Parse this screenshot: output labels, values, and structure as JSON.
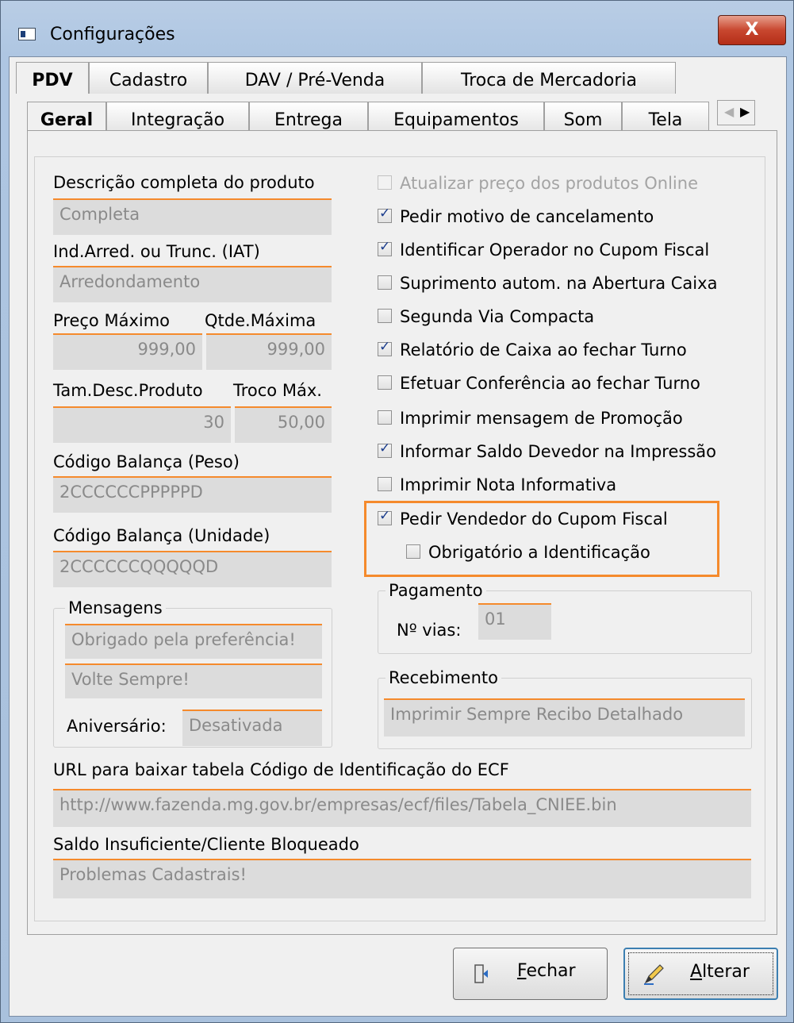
{
  "window": {
    "title": "Configurações",
    "close_label": "X"
  },
  "tabs_row1": [
    "PDV",
    "Cadastro",
    "DAV / Pré-Venda",
    "Troca de Mercadoria"
  ],
  "tabs_row2": [
    "Geral",
    "Integração",
    "Entrega",
    "Equipamentos",
    "Som",
    "Tela"
  ],
  "left": {
    "descricao_label": "Descrição completa do produto",
    "descricao_value": "Completa",
    "iat_label": "Ind.Arred. ou Trunc. (IAT)",
    "iat_value": "Arredondamento",
    "preco_max_label": "Preço Máximo",
    "qtde_max_label": "Qtde.Máxima",
    "preco_max_value": "999,00",
    "qtde_max_value": "999,00",
    "tam_desc_label": "Tam.Desc.Produto",
    "troco_max_label": "Troco Máx.",
    "tam_desc_value": "30",
    "troco_max_value": "50,00",
    "cod_peso_label": "Código Balança (Peso)",
    "cod_peso_value": "2CCCCCCPPPPPD",
    "cod_unid_label": "Código Balança (Unidade)",
    "cod_unid_value": "2CCCCCCQQQQQD"
  },
  "mensagens": {
    "title": "Mensagens",
    "msg1": "Obrigado pela preferência!",
    "msg2": "Volte Sempre!",
    "aniversario_label": "Aniversário:",
    "aniversario_value": "Desativada"
  },
  "checkboxes": [
    {
      "label": "Atualizar preço dos produtos Online",
      "checked": false,
      "disabled": true
    },
    {
      "label": "Pedir motivo de cancelamento",
      "checked": true,
      "disabled": false
    },
    {
      "label": "Identificar Operador no Cupom Fiscal",
      "checked": true,
      "disabled": false
    },
    {
      "label": "Suprimento autom. na Abertura Caixa",
      "checked": false,
      "disabled": false
    },
    {
      "label": "Segunda Via Compacta",
      "checked": false,
      "disabled": false
    },
    {
      "label": "Relatório de Caixa ao fechar Turno",
      "checked": true,
      "disabled": false
    },
    {
      "label": "Efetuar Conferência ao fechar Turno",
      "checked": false,
      "disabled": false
    },
    {
      "label": "Imprimir mensagem de Promoção",
      "checked": false,
      "disabled": false
    },
    {
      "label": "Informar Saldo Devedor na Impressão",
      "checked": true,
      "disabled": false
    },
    {
      "label": "Imprimir Nota Informativa",
      "checked": false,
      "disabled": false
    },
    {
      "label": "Pedir Vendedor do Cupom Fiscal",
      "checked": true,
      "disabled": false
    },
    {
      "label": "Obrigatório a Identificação",
      "checked": false,
      "disabled": false
    }
  ],
  "pagamento": {
    "title": "Pagamento",
    "vias_label": "Nº vias:",
    "vias_value": "01"
  },
  "recebimento": {
    "title": "Recebimento",
    "value": "Imprimir Sempre Recibo Detalhado"
  },
  "url": {
    "label": "URL para baixar tabela Código de Identificação do ECF",
    "value": "http://www.fazenda.mg.gov.br/empresas/ecf/files/Tabela_CNIEE.bin"
  },
  "saldo": {
    "label": "Saldo Insuficiente/Cliente Bloqueado",
    "value": "Problemas Cadastrais!"
  },
  "buttons": {
    "fechar_first": "F",
    "fechar_rest": "echar",
    "alterar_first": "A",
    "alterar_rest": "lterar"
  },
  "colors": {
    "accent": "#f58a2c",
    "field_bg": "#dcdcdc",
    "check": "#1a3c8c"
  }
}
